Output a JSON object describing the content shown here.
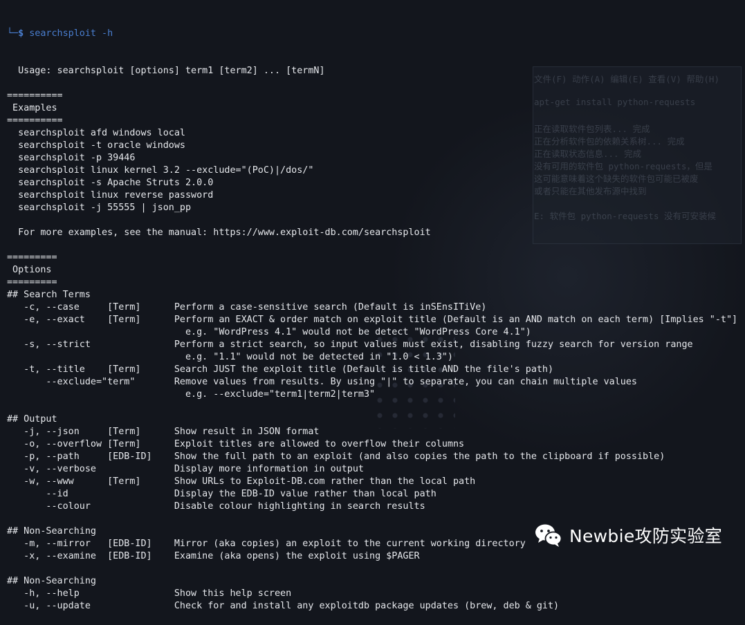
{
  "prompt": {
    "corner": "└─",
    "symbol": "$",
    "command": "searchsploit -h"
  },
  "output_lines": [
    "  Usage: searchsploit [options] term1 [term2] ... [termN]",
    "",
    "==========",
    " Examples",
    "==========",
    "  searchsploit afd windows local",
    "  searchsploit -t oracle windows",
    "  searchsploit -p 39446",
    "  searchsploit linux kernel 3.2 --exclude=\"(PoC)|/dos/\"",
    "  searchsploit -s Apache Struts 2.0.0",
    "  searchsploit linux reverse password",
    "  searchsploit -j 55555 | json_pp",
    "",
    "  For more examples, see the manual: https://www.exploit-db.com/searchsploit",
    "",
    "=========",
    " Options",
    "=========",
    "## Search Terms",
    "   -c, --case     [Term]      Perform a case-sensitive search (Default is inSEnsITiVe)",
    "   -e, --exact    [Term]      Perform an EXACT & order match on exploit title (Default is an AND match on each term) [Implies \"-t\"]",
    "                                e.g. \"WordPress 4.1\" would not be detect \"WordPress Core 4.1\")",
    "   -s, --strict               Perform a strict search, so input values must exist, disabling fuzzy search for version range",
    "                                e.g. \"1.1\" would not be detected in \"1.0 < 1.3\")",
    "   -t, --title    [Term]      Search JUST the exploit title (Default is title AND the file's path)",
    "       --exclude=\"term\"       Remove values from results. By using \"|\" to separate, you can chain multiple values",
    "                                e.g. --exclude=\"term1|term2|term3\"",
    "",
    "## Output",
    "   -j, --json     [Term]      Show result in JSON format",
    "   -o, --overflow [Term]      Exploit titles are allowed to overflow their columns",
    "   -p, --path     [EDB-ID]    Show the full path to an exploit (and also copies the path to the clipboard if possible)",
    "   -v, --verbose              Display more information in output",
    "   -w, --www      [Term]      Show URLs to Exploit-DB.com rather than the local path",
    "       --id                   Display the EDB-ID value rather than local path",
    "       --colour               Disable colour highlighting in search results",
    "",
    "## Non-Searching",
    "   -m, --mirror   [EDB-ID]    Mirror (aka copies) an exploit to the current working directory",
    "   -x, --examine  [EDB-ID]    Examine (aka opens) the exploit using $PAGER",
    "",
    "## Non-Searching",
    "   -h, --help                 Show this help screen",
    "   -u, --update               Check for and install any exploitdb package updates (brew, deb & git)"
  ],
  "watermark": {
    "logo_icon": "wechat-logo-icon",
    "text": "Newbie攻防实验室"
  },
  "background_window_lines": [
    "文件(F) 动作(A) 编辑(E) 查看(V) 帮助(H)",
    "apt-get install python-requests",
    "正在读取软件包列表... 完成",
    "正在分析软件包的依赖关系树... 完成",
    "正在读取状态信息... 完成",
    "没有可用的软件包 python-requests，但是",
    "这可能意味着这个缺失的软件包可能已被废",
    "或者只能在其他发布源中找到",
    "E: 软件包 python-requests 没有可安装候"
  ],
  "colors": {
    "background": "#13161d",
    "text": "#e6e8ec",
    "prompt": "#4a7fd1",
    "watermark_text": "#ffffff"
  }
}
